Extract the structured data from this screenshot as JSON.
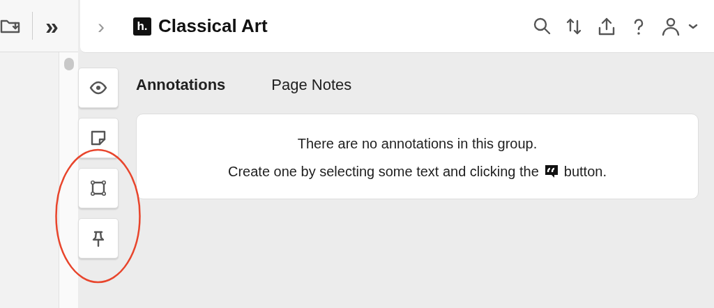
{
  "browser_toolbar": {
    "overflow_label": "»"
  },
  "header": {
    "collapse_label": "›",
    "logo_text": "h.",
    "group_name": "Classical Art"
  },
  "tools": [
    {
      "kind": "eye"
    },
    {
      "kind": "note"
    },
    {
      "kind": "rect"
    },
    {
      "kind": "pin"
    }
  ],
  "tabs": [
    {
      "label": "Annotations",
      "selected": true
    },
    {
      "label": "Page Notes",
      "selected": false
    }
  ],
  "empty_message": {
    "line_1": "There are no annotations in this group.",
    "line_2_before_icon": "Create one by selecting some text and clicking the",
    "line_2_after_icon": "button."
  }
}
